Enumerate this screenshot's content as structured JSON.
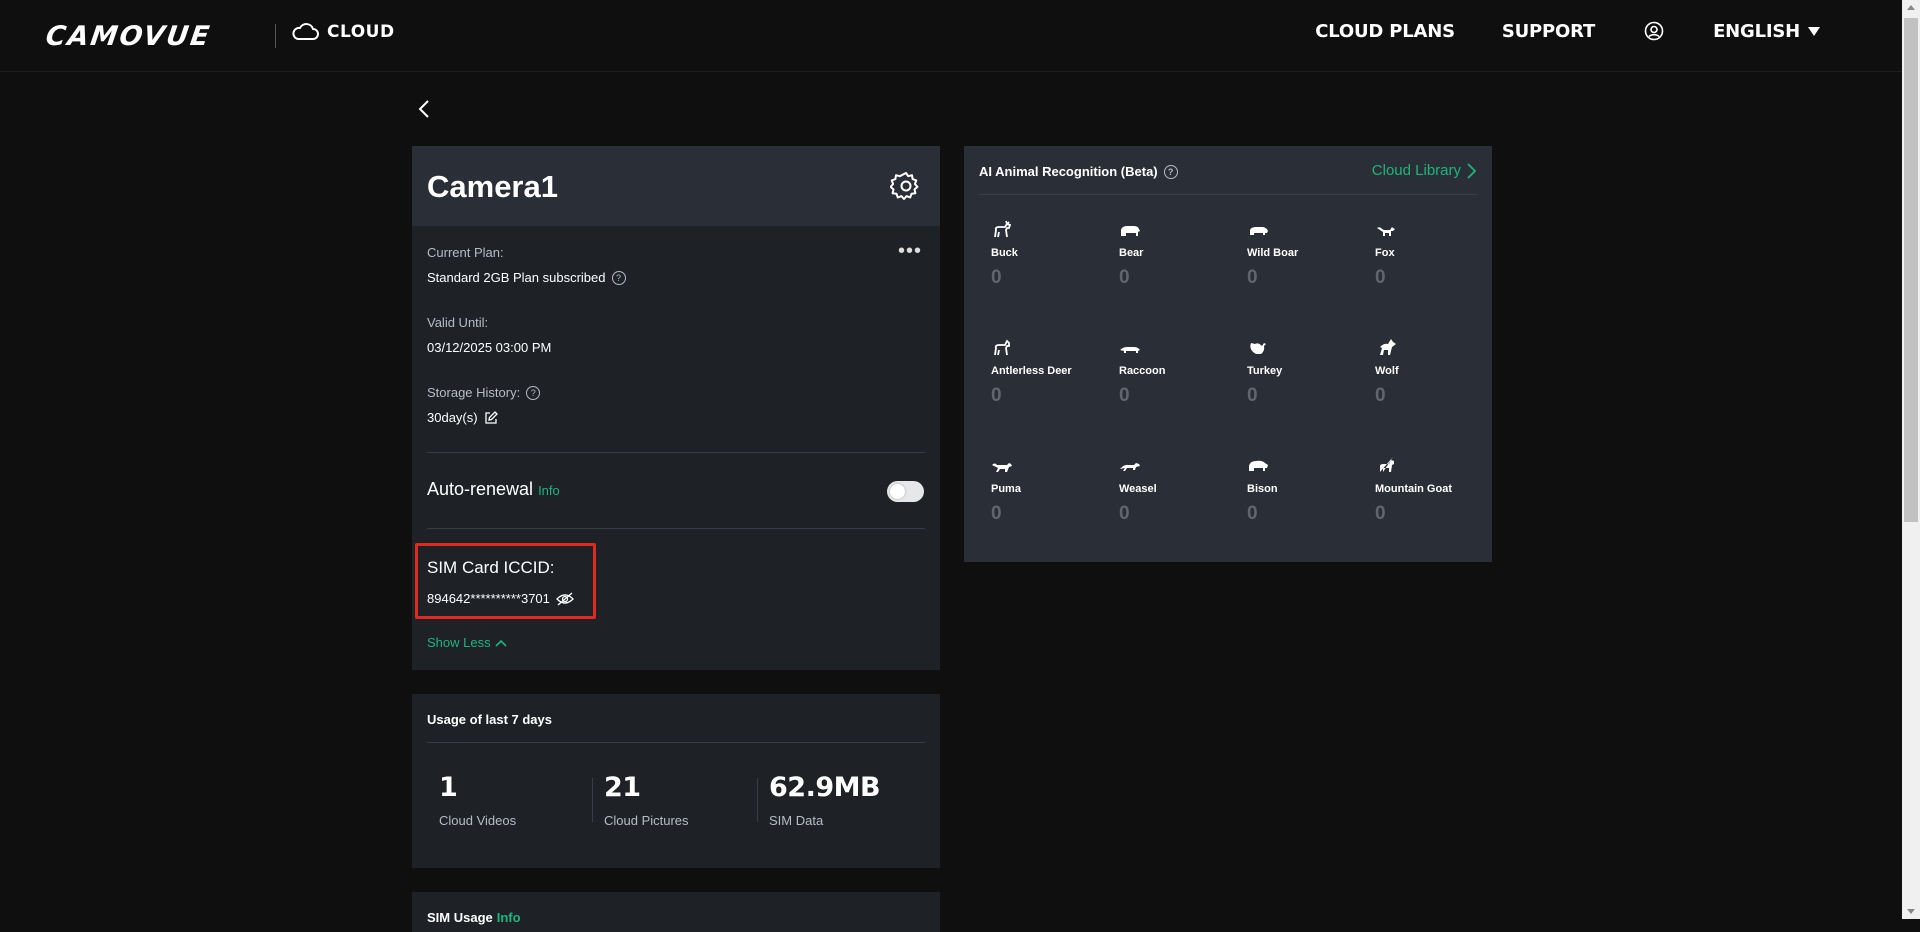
{
  "header": {
    "logo": "CAMOVUE",
    "cloud_label": "CLOUD",
    "nav": {
      "cloud_plans": "CLOUD PLANS",
      "support": "SUPPORT",
      "language": "ENGLISH"
    }
  },
  "camera": {
    "name": "Camera1",
    "current_plan_label": "Current Plan:",
    "current_plan_value": "Standard 2GB Plan subscribed",
    "valid_until_label": "Valid Until:",
    "valid_until_value": "03/12/2025 03:00 PM",
    "storage_history_label": "Storage History:",
    "storage_history_value": "30day(s)",
    "auto_renewal_label": "Auto-renewal",
    "auto_renewal_info": "Info",
    "auto_renewal_on": false,
    "sim_iccid_label": "SIM Card ICCID:",
    "sim_iccid_value": "894642**********3701",
    "show_less": "Show Less"
  },
  "usage": {
    "title": "Usage of last 7 days",
    "stats": [
      {
        "value": "1",
        "label": "Cloud Videos"
      },
      {
        "value": "21",
        "label": "Cloud Pictures"
      },
      {
        "value": "62.9MB",
        "label": "SIM Data"
      }
    ]
  },
  "sim_usage": {
    "title": "SIM Usage",
    "info": "Info"
  },
  "ai": {
    "title": "AI Animal Recognition (Beta)",
    "cloud_library": "Cloud Library",
    "animals": [
      {
        "name": "Buck",
        "count": "0",
        "icon": "deer-icon"
      },
      {
        "name": "Bear",
        "count": "0",
        "icon": "bear-icon"
      },
      {
        "name": "Wild Boar",
        "count": "0",
        "icon": "boar-icon"
      },
      {
        "name": "Fox",
        "count": "0",
        "icon": "fox-icon"
      },
      {
        "name": "Antlerless Deer",
        "count": "0",
        "icon": "doe-icon"
      },
      {
        "name": "Raccoon",
        "count": "0",
        "icon": "raccoon-icon"
      },
      {
        "name": "Turkey",
        "count": "0",
        "icon": "turkey-icon"
      },
      {
        "name": "Wolf",
        "count": "0",
        "icon": "wolf-icon"
      },
      {
        "name": "Puma",
        "count": "0",
        "icon": "puma-icon"
      },
      {
        "name": "Weasel",
        "count": "0",
        "icon": "weasel-icon"
      },
      {
        "name": "Bison",
        "count": "0",
        "icon": "bison-icon"
      },
      {
        "name": "Mountain Goat",
        "count": "0",
        "icon": "goat-icon"
      }
    ]
  },
  "colors": {
    "accent": "#1fb47e",
    "highlight": "#e0291f",
    "card": "#1e2227",
    "card_header": "#2a2f37"
  }
}
